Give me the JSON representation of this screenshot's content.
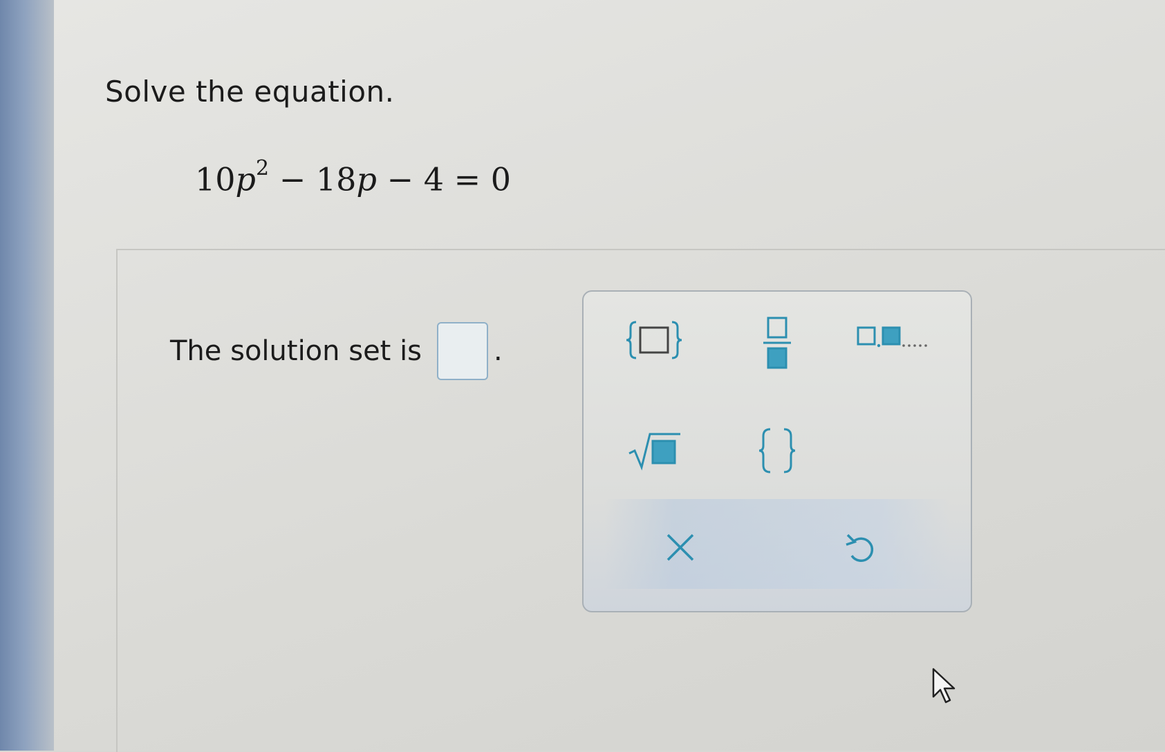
{
  "question": {
    "title": "Solve the equation.",
    "equation": {
      "coef1": "10",
      "var1": "p",
      "exp": "2",
      "op1": "−",
      "coef2": "18",
      "var2": "p",
      "op2": "−",
      "const": "4",
      "eq": "=",
      "rhs": "0"
    }
  },
  "answer": {
    "prompt": "The solution set is",
    "period": ".",
    "input_value": ""
  },
  "palette": {
    "buttons": [
      {
        "name": "set-braces-box",
        "icon": "set-braces-box-icon"
      },
      {
        "name": "fraction",
        "icon": "fraction-icon"
      },
      {
        "name": "list-boxes",
        "icon": "list-boxes-icon"
      },
      {
        "name": "square-root",
        "icon": "square-root-icon"
      },
      {
        "name": "empty-set",
        "icon": "empty-braces-icon"
      },
      {
        "name": "clear",
        "icon": "close-icon"
      },
      {
        "name": "undo",
        "icon": "undo-icon"
      }
    ],
    "accent": "#2c8fb0"
  },
  "colors": {
    "icon_color": "#2c8fb0",
    "box_border": "#8fb0c8"
  }
}
